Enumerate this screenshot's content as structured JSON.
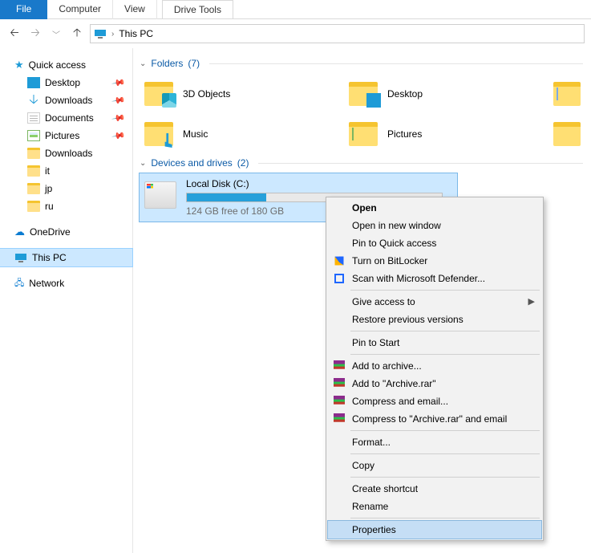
{
  "ribbon": {
    "file": "File",
    "computer": "Computer",
    "view": "View",
    "driveTools": "Drive Tools"
  },
  "breadcrumb": {
    "location": "This PC"
  },
  "sidebar": {
    "quickAccess": "Quick access",
    "qa": [
      {
        "label": "Desktop",
        "pinned": true
      },
      {
        "label": "Downloads",
        "pinned": true
      },
      {
        "label": "Documents",
        "pinned": true
      },
      {
        "label": "Pictures",
        "pinned": true
      },
      {
        "label": "Downloads",
        "pinned": false
      },
      {
        "label": "it",
        "pinned": false
      },
      {
        "label": "jp",
        "pinned": false
      },
      {
        "label": "ru",
        "pinned": false
      }
    ],
    "onedrive": "OneDrive",
    "thispc": "This PC",
    "network": "Network"
  },
  "sections": {
    "folders": {
      "title": "Folders",
      "count": "(7)"
    },
    "devices": {
      "title": "Devices and drives",
      "count": "(2)"
    }
  },
  "folders": {
    "f1": "3D Objects",
    "f2": "Desktop",
    "f3": "Music",
    "f4": "Pictures"
  },
  "drive": {
    "name": "Local Disk (C:)",
    "free": "124 GB free of 180 GB",
    "fillPercent": 31
  },
  "ctx": {
    "open": "Open",
    "opennew": "Open in new window",
    "pin": "Pin to Quick access",
    "bitlocker": "Turn on BitLocker",
    "defender": "Scan with Microsoft Defender...",
    "give": "Give access to",
    "restore": "Restore previous versions",
    "pinstart": "Pin to Start",
    "addarch": "Add to archive...",
    "addto": "Add to \"Archive.rar\"",
    "compemail": "Compress and email...",
    "comptoemail": "Compress to \"Archive.rar\" and email",
    "format": "Format...",
    "copy": "Copy",
    "shortcut": "Create shortcut",
    "rename": "Rename",
    "properties": "Properties"
  }
}
